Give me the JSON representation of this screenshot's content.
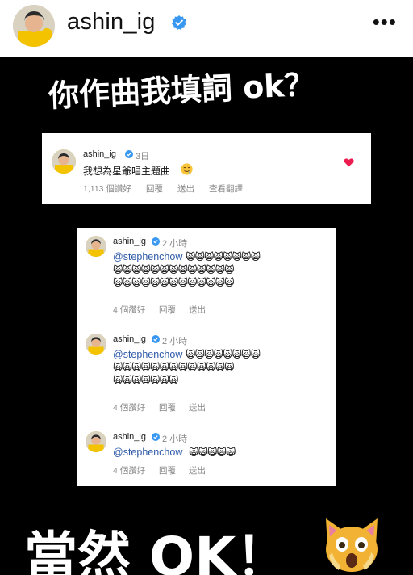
{
  "header": {
    "username": "ashin_ig",
    "more_icon": "more-horizontal-icon"
  },
  "story": {
    "title_top": "你作曲我填詞 ok？",
    "title_bottom": "當然 OK！",
    "big_emoji": "scream-cat-icon",
    "comment_main": {
      "username": "ashin_ig",
      "time": "3日",
      "text": "我想為星爺唱主題曲",
      "emoji": "drooling-face-icon",
      "likes": "1,113 個讚好",
      "reply": "回覆",
      "send": "送出",
      "translate": "查看翻譯"
    },
    "replies": [
      {
        "username": "ashin_ig",
        "time": "2 小時",
        "mention": "@stephenchow",
        "cat_lines": [
          "🙀🙀🙀🙀🙀🙀🙀🙀",
          "🙀🙀🙀🙀🙀🙀🙀🙀🙀🙀🙀🙀🙀",
          "🙀🙀🙀🙀🙀🙀🙀🙀🙀🙀🙀🙀🙀"
        ],
        "likes": "4 個讚好",
        "reply": "回覆",
        "send": "送出"
      },
      {
        "username": "ashin_ig",
        "time": "2 小時",
        "mention": "@stephenchow",
        "cat_lines": [
          "🙀🙀🙀🙀🙀🙀🙀🙀",
          "🙀🙀🙀🙀🙀🙀🙀🙀🙀🙀🙀🙀🙀",
          "🙀🙀🙀🙀🙀🙀🙀"
        ],
        "likes": "4 個讚好",
        "reply": "回覆",
        "send": "送出"
      },
      {
        "username": "ashin_ig",
        "time": "2 小時",
        "mention": "@stephenchow",
        "cat_lines": [
          "🙀🙀🙀🙀🙀"
        ],
        "likes": "4 個讚好",
        "reply": "回覆",
        "send": "送出"
      }
    ]
  },
  "colors": {
    "verified": "#3897f0",
    "heart": "#ed1c4f",
    "mention": "#2f5aa8",
    "story_bg": "#000000"
  }
}
